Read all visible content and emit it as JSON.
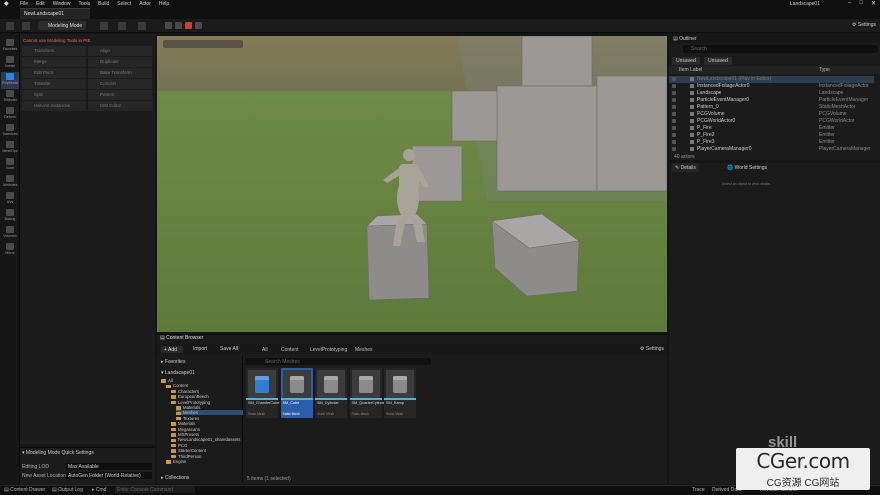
{
  "menu": [
    "File",
    "Edit",
    "Window",
    "Tools",
    "Build",
    "Select",
    "Actor",
    "Help"
  ],
  "project_name": "Landscape01",
  "window_controls": [
    "–",
    "□",
    "✕"
  ],
  "level_tab": "NewLandscape01",
  "toolbar": {
    "mode_label": "Modeling Mode",
    "settings_label": "Settings"
  },
  "left_bar": [
    "Favorites",
    "Create",
    "PolyModel",
    "TriModel",
    "Deform",
    "Transform",
    "MeshOps",
    "Voxel",
    "Attributes",
    "UVs",
    "Baking",
    "Volumes",
    "Mirror"
  ],
  "tool_panel": {
    "warning": "Cannot use Modeling Tools in PIE",
    "tools": [
      "Transform",
      "Align",
      "Merge",
      "Duplicate",
      "Edit Pivot",
      "Bake Transform",
      "Transfer",
      "Convert",
      "Split",
      "Pattern",
      "Harvest Instances",
      "ISM Editor"
    ]
  },
  "quick_settings": {
    "title": "Modeling Mode Quick Settings",
    "rows": [
      {
        "label": "Editing LOD",
        "value": "Max Available"
      },
      {
        "label": "New Asset Location",
        "value": "AutoGen Folder (World-Relative)"
      }
    ]
  },
  "outliner": {
    "title": "Outliner",
    "search_placeholder": "Search",
    "filters": [
      "Unsaved",
      "Unsaved"
    ],
    "col_label": "Item Label",
    "col_type": "Type",
    "rows": [
      {
        "label": "NewLandscape01 (Play in Editor)",
        "type": "",
        "dim": true
      },
      {
        "label": "InstancedFoliageActor0",
        "type": "InstancedFoliageActor"
      },
      {
        "label": "Landscape",
        "type": "Landscape"
      },
      {
        "label": "ParticleEventManager0",
        "type": "ParticleEventManager"
      },
      {
        "label": "Pattern_0",
        "type": "StaticMeshActor"
      },
      {
        "label": "PCGVolume",
        "type": "PCGVolume"
      },
      {
        "label": "PCGWorldActor0",
        "type": "PCGWorldActor"
      },
      {
        "label": "P_Fire",
        "type": "Emitter"
      },
      {
        "label": "P_Fire2",
        "type": "Emitter"
      },
      {
        "label": "P_Fire3",
        "type": "Emitter"
      },
      {
        "label": "PlayerCameraManager0",
        "type": "PlayerCameraManager"
      }
    ],
    "footer": "40 actors"
  },
  "details": {
    "tab1": "Details",
    "tab2": "World Settings",
    "empty_msg": "Select an object to view details"
  },
  "content_browser": {
    "tab": "Content Browser",
    "add": "+ Add",
    "import": "Import",
    "save_all": "Save All",
    "breadcrumb": [
      "All",
      "Content",
      "LevelPrototyping",
      "Meshes"
    ],
    "settings": "Settings",
    "favorites": "Favorites",
    "project": "Landscape01",
    "search_placeholder": "Search Meshes",
    "tree": [
      {
        "label": "All",
        "indent": 0
      },
      {
        "label": "Content",
        "indent": 1
      },
      {
        "label": "Characters",
        "indent": 2
      },
      {
        "label": "EuropeanBeech",
        "indent": 2
      },
      {
        "label": "LevelPrototyping",
        "indent": 2
      },
      {
        "label": "Materials",
        "indent": 3
      },
      {
        "label": "Meshes",
        "indent": 3,
        "selected": true
      },
      {
        "label": "Textures",
        "indent": 3
      },
      {
        "label": "Materials",
        "indent": 2
      },
      {
        "label": "Megascans",
        "indent": 2
      },
      {
        "label": "MSPresets",
        "indent": 2
      },
      {
        "label": "NewLandscape01_sharedassets",
        "indent": 2
      },
      {
        "label": "PCG",
        "indent": 2
      },
      {
        "label": "StarterContent",
        "indent": 2
      },
      {
        "label": "ThirdPerson",
        "indent": 2
      },
      {
        "label": "Engine",
        "indent": 1
      }
    ],
    "collections": "Collections",
    "assets": [
      {
        "name": "SM_ChamferCube",
        "type": "Static Mesh",
        "color": "#2f7fd6"
      },
      {
        "name": "SM_Cube",
        "type": "Static Mesh",
        "color": "#8a8a8a",
        "selected": true
      },
      {
        "name": "SM_Cylinder",
        "type": "Static Mesh",
        "color": "#8a8a8a"
      },
      {
        "name": "SM_QuarterCylinder",
        "type": "Static Mesh",
        "color": "#8a8a8a"
      },
      {
        "name": "SM_Ramp",
        "type": "Static Mesh",
        "color": "#8a8a8a"
      }
    ],
    "footer": "5 items (1 selected)"
  },
  "status_bar": {
    "content_drawer": "Content Drawer",
    "output_log": "Output Log",
    "cmd": "Cmd",
    "cmd_placeholder": "Enter Console Command",
    "trace": "Trace",
    "derived_data": "Derived Data",
    "revision": "Revision Control"
  },
  "watermark": {
    "main": "CGer.com",
    "sub": "CG资源 CG网站",
    "brand": "skill"
  },
  "colors": {
    "accent": "#2f84e0",
    "warning": "#e06a5a",
    "folder": "#c99a3f",
    "selection": "#2d4d73"
  }
}
